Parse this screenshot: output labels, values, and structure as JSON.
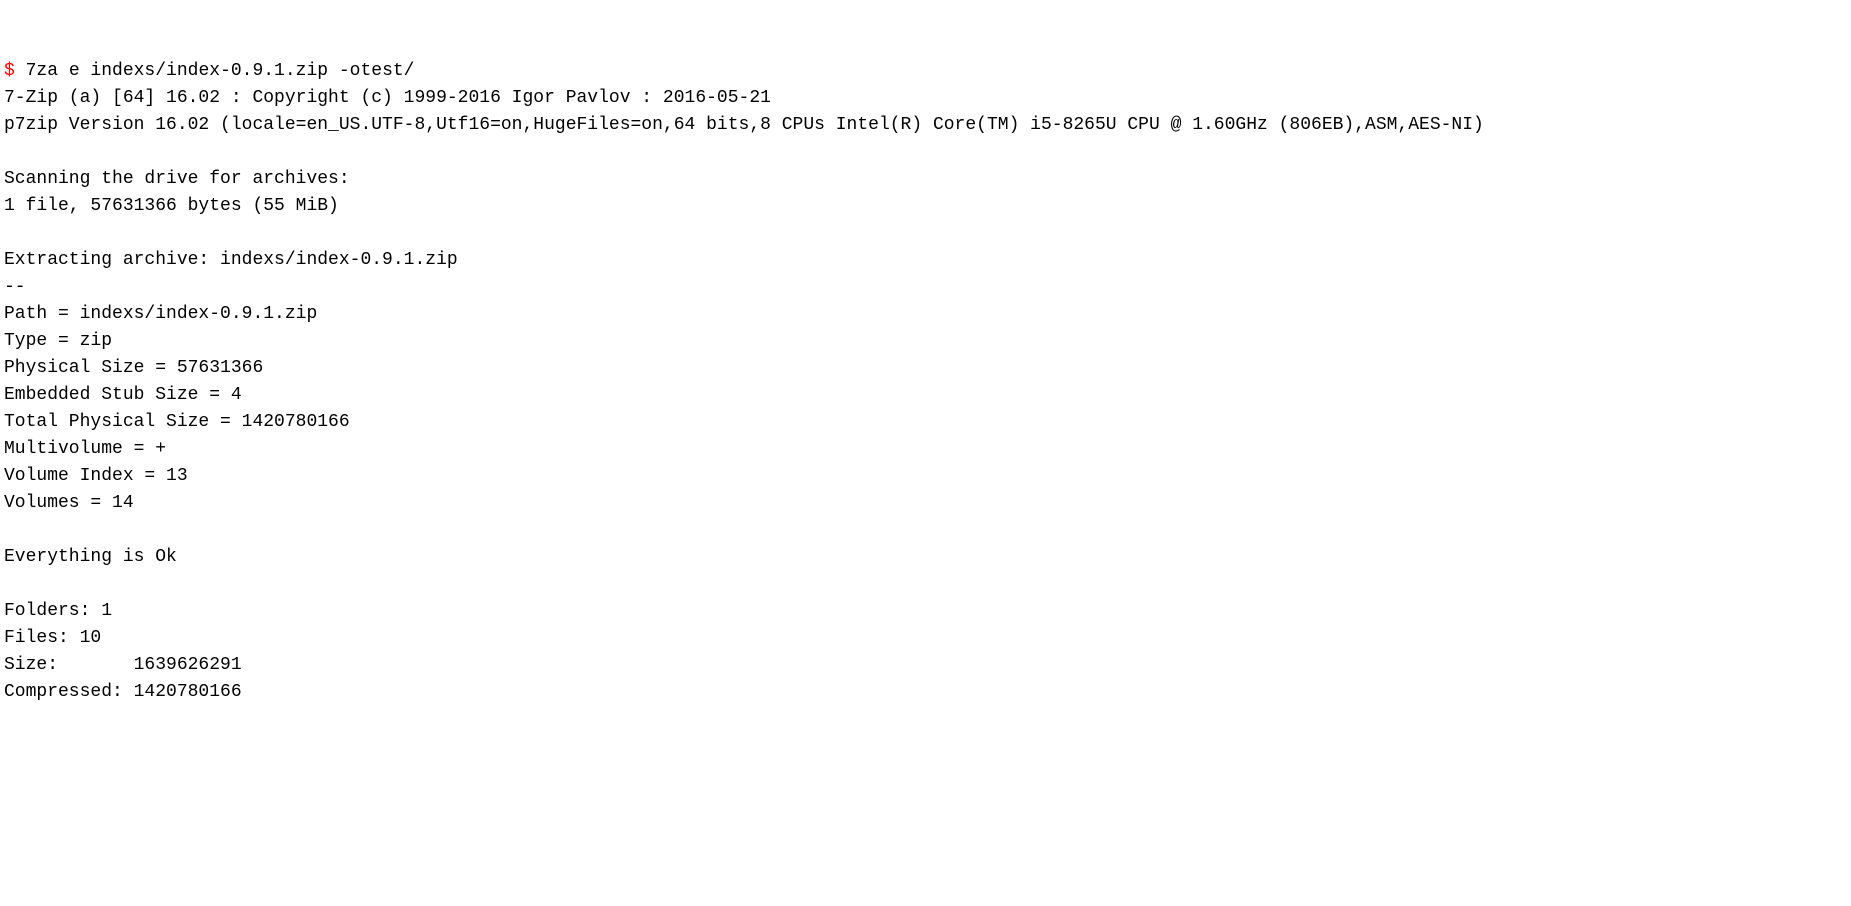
{
  "prompt": "$",
  "command": " 7za e indexs/index-0.9.1.zip -otest/",
  "output": "\n7-Zip (a) [64] 16.02 : Copyright (c) 1999-2016 Igor Pavlov : 2016-05-21\np7zip Version 16.02 (locale=en_US.UTF-8,Utf16=on,HugeFiles=on,64 bits,8 CPUs Intel(R) Core(TM) i5-8265U CPU @ 1.60GHz (806EB),ASM,AES-NI)\n\nScanning the drive for archives:\n1 file, 57631366 bytes (55 MiB)\n\nExtracting archive: indexs/index-0.9.1.zip\n--\nPath = indexs/index-0.9.1.zip\nType = zip\nPhysical Size = 57631366\nEmbedded Stub Size = 4\nTotal Physical Size = 1420780166\nMultivolume = +\nVolume Index = 13\nVolumes = 14\n\nEverything is Ok\n\nFolders: 1\nFiles: 10\nSize:       1639626291\nCompressed: 1420780166"
}
